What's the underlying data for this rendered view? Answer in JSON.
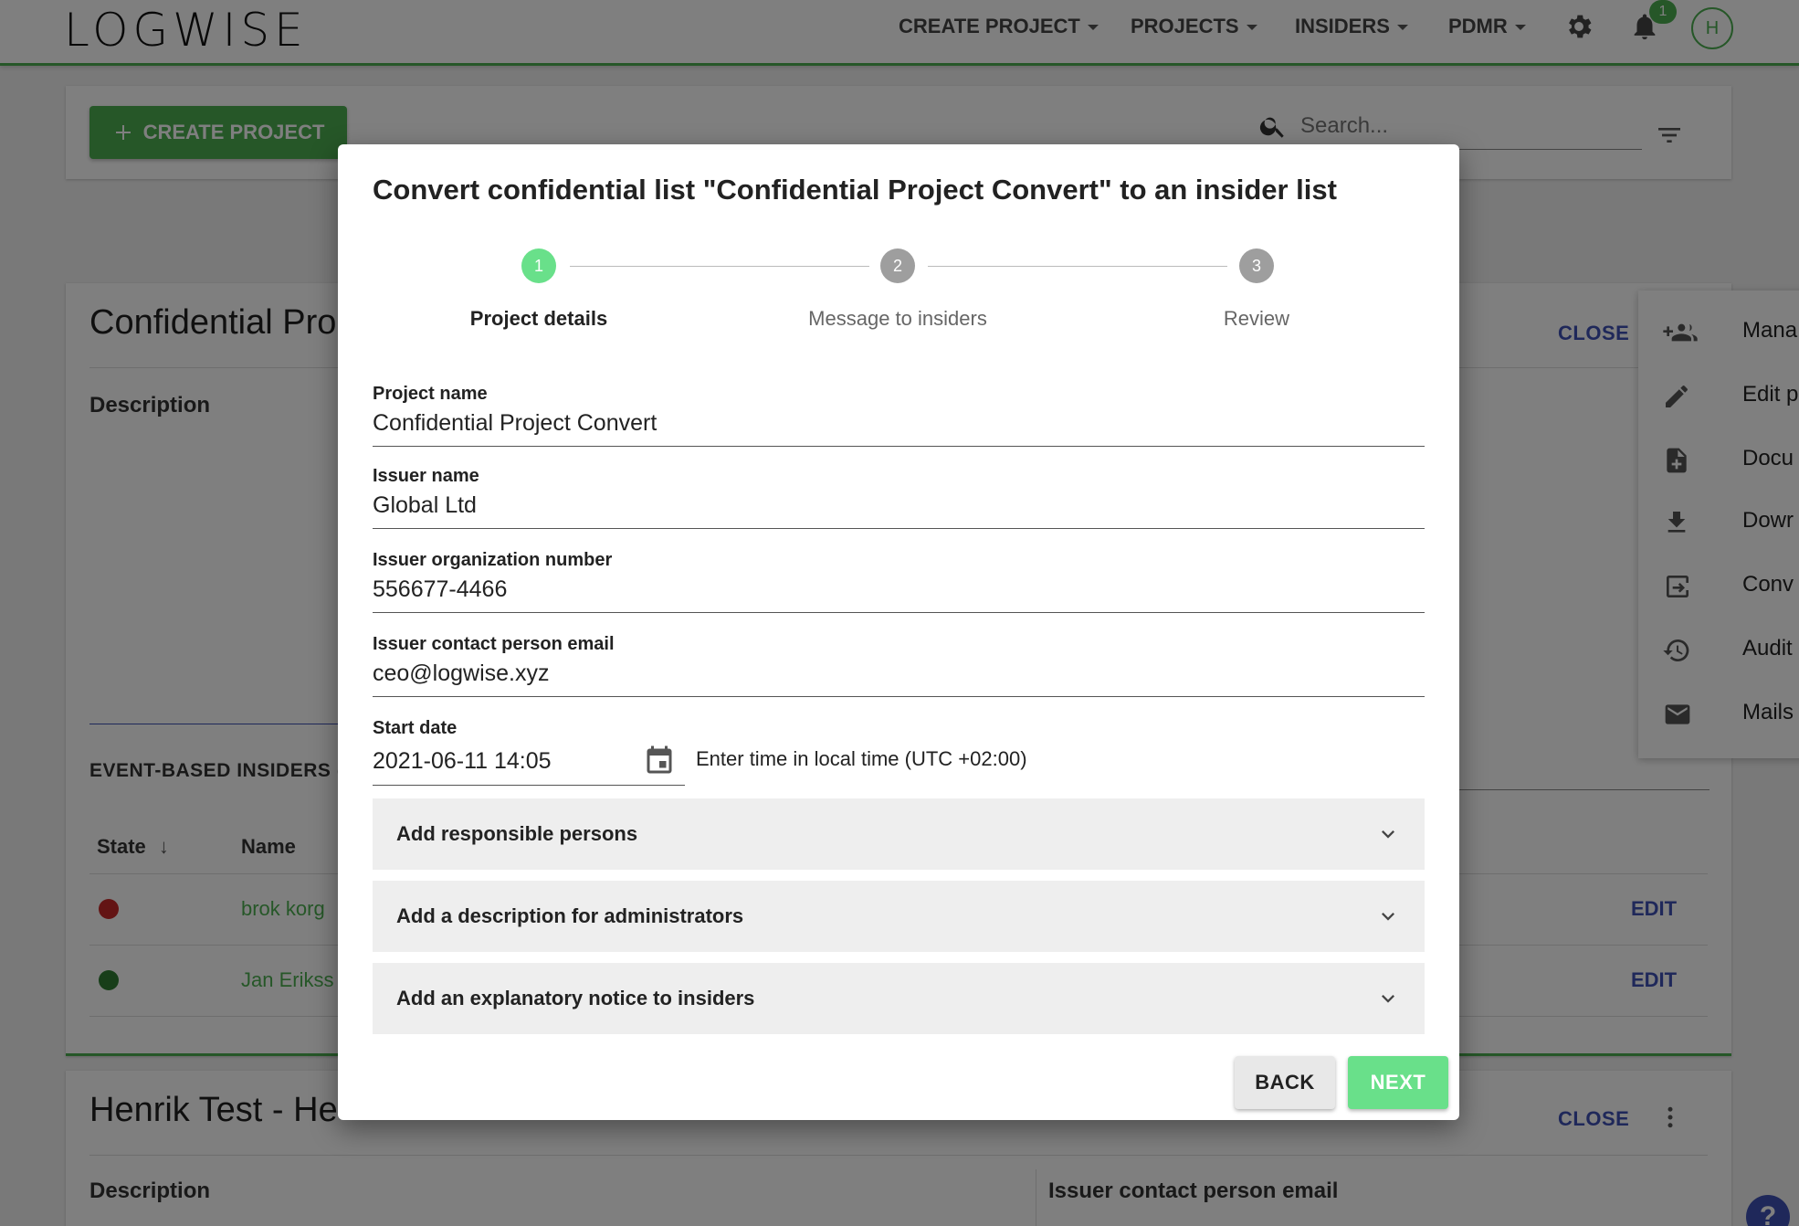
{
  "app": {
    "logo": "LOGWISE"
  },
  "nav": {
    "items": [
      {
        "label": "CREATE PROJECT"
      },
      {
        "label": "PROJECTS"
      },
      {
        "label": "INSIDERS"
      },
      {
        "label": "PDMR"
      }
    ],
    "notification_count": "1",
    "avatar_initial": "H"
  },
  "toolbar": {
    "create_button": "CREATE PROJECT",
    "search_placeholder": "Search..."
  },
  "project_card": {
    "title": "Confidential Pro",
    "close_label": "CLOSE",
    "description_label": "Description",
    "event_section": "EVENT-BASED INSIDERS (",
    "columns": {
      "state": "State",
      "name": "Name"
    },
    "rows": [
      {
        "state_color": "#c62828",
        "name": "brok korg",
        "edit": "EDIT"
      },
      {
        "state_color": "#2e7d32",
        "name": "Jan Erikss",
        "edit": "EDIT"
      }
    ]
  },
  "project_card2": {
    "title": "Henrik Test - He",
    "close_label": "CLOSE",
    "description_label": "Description",
    "issuer_email_label": "Issuer contact person email"
  },
  "side_menu": {
    "items": [
      {
        "icon": "add-group-icon",
        "label": "Mana"
      },
      {
        "icon": "pencil-icon",
        "label": "Edit p"
      },
      {
        "icon": "document-add-icon",
        "label": "Docu"
      },
      {
        "icon": "download-icon",
        "label": "Dowr"
      },
      {
        "icon": "convert-icon",
        "label": "Conv"
      },
      {
        "icon": "history-icon",
        "label": "Audit"
      },
      {
        "icon": "mail-icon",
        "label": "Mails"
      }
    ]
  },
  "dialog": {
    "title": "Convert confidential list \"Confidential Project Convert\" to an insider list",
    "steps": [
      {
        "number": "1",
        "label": "Project details",
        "active": true
      },
      {
        "number": "2",
        "label": "Message to insiders",
        "active": false
      },
      {
        "number": "3",
        "label": "Review",
        "active": false
      }
    ],
    "fields": {
      "project_name": {
        "label": "Project name",
        "value": "Confidential Project Convert"
      },
      "issuer_name": {
        "label": "Issuer name",
        "value": "Global Ltd"
      },
      "issuer_org": {
        "label": "Issuer organization number",
        "value": "556677-4466"
      },
      "issuer_email": {
        "label": "Issuer contact person email",
        "value": "ceo@logwise.xyz"
      },
      "start_date": {
        "label": "Start date",
        "value": "2021-06-11 14:05"
      }
    },
    "timezone_note": "Enter time in local time (UTC +02:00)",
    "accordions": [
      {
        "label": "Add responsible persons"
      },
      {
        "label": "Add a description for administrators"
      },
      {
        "label": "Add an explanatory notice to insiders"
      }
    ],
    "buttons": {
      "back": "BACK",
      "next": "NEXT"
    }
  },
  "colors": {
    "accent": "#4caf50",
    "link": "#3f51b5",
    "step_active": "#69e08a",
    "step_inactive": "#9e9e9e"
  }
}
